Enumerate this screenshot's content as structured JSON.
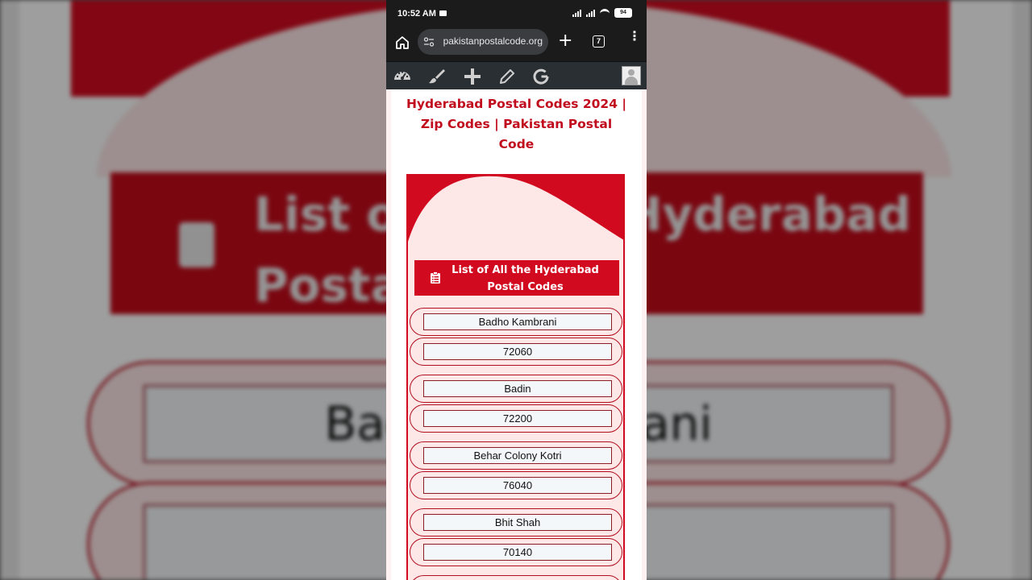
{
  "status_bar": {
    "time": "10:52 AM",
    "battery": "94"
  },
  "browser": {
    "url": "pakistanpostalcode.org",
    "tab_count": "7",
    "new_tab_label": "+",
    "menu_label": "⋮"
  },
  "toolbar": {
    "icons": [
      "dashboard-icon",
      "brush-icon",
      "plus-icon",
      "pencil-icon",
      "google-icon",
      "avatar"
    ]
  },
  "page": {
    "title": "Hyderabad Postal Codes 2024 | Zip Codes | Pakistan Postal Code",
    "list_header": "List of All the Hyderabad Postal Codes",
    "entries": [
      {
        "area": "Badho Kambrani",
        "code": "72060"
      },
      {
        "area": "Badin",
        "code": "72200"
      },
      {
        "area": "Behar Colony Kotri",
        "code": "76040"
      },
      {
        "area": "Bhit Shah",
        "code": "70140"
      }
    ]
  },
  "background": {
    "banner_text": "List of All the Hyderabad Postal Codes",
    "zoomed_entry": "Badho Kambrani"
  },
  "colors": {
    "accent_red": "#d20a1f",
    "title_red": "#c10c1d",
    "pink_bg": "#fde7e7",
    "field_bg": "#f4f7f9"
  }
}
